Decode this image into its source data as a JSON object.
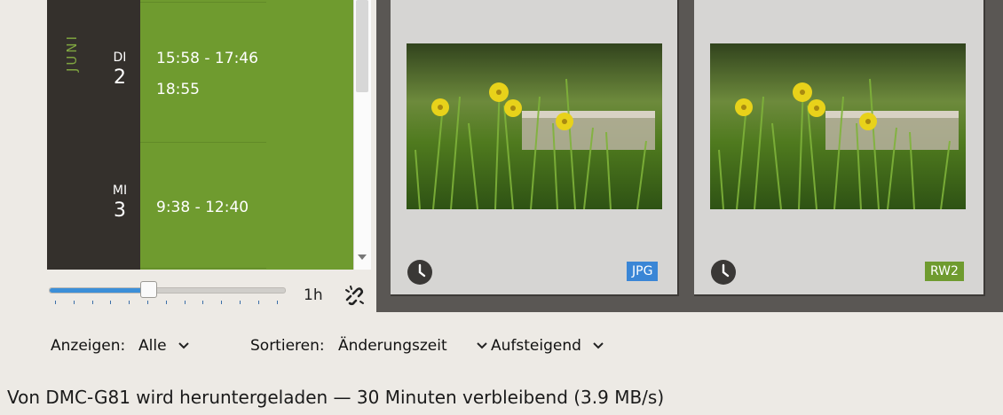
{
  "timeline": {
    "month": "JUNI",
    "days": [
      {
        "weekday": "DI",
        "day": "2",
        "times": [
          "15:58 - 17:46",
          "18:55"
        ]
      },
      {
        "weekday": "MI",
        "day": "3",
        "times": [
          "9:38 - 12:40"
        ]
      }
    ]
  },
  "zoom": {
    "label": "1h",
    "level_percent": 40
  },
  "thumbnails": [
    {
      "format": "JPG",
      "badge_color": "#3a86d6"
    },
    {
      "format": "RW2",
      "badge_color": "#6f9b2f"
    }
  ],
  "filters": {
    "show_label": "Anzeigen:",
    "show_value": "Alle",
    "sort_label": "Sortieren:",
    "sort_value": "Änderungszeit",
    "order_value": "Aufsteigend"
  },
  "status": "Von DMC-G81 wird heruntergeladen — 30 Minuten verbleibend (3.9 MB/s)"
}
